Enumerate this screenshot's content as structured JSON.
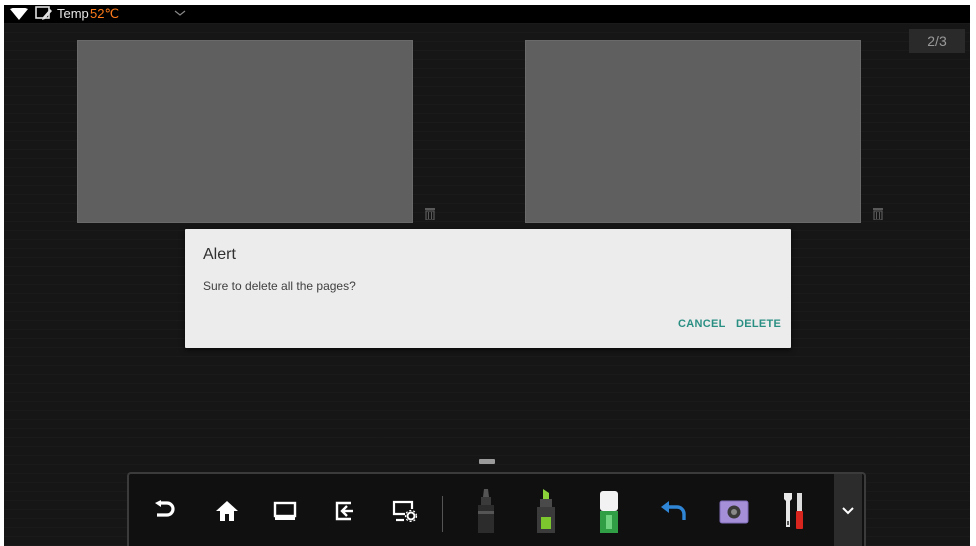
{
  "status_bar": {
    "temp_label": "Temp",
    "temp_value": "52℃",
    "temp_color": "#ff7a1a",
    "icons": [
      "wifi-icon",
      "whiteboard-icon",
      "chevron-down-icon"
    ]
  },
  "page_counter": "2/3",
  "thumbnails": [
    {
      "name": "page-thumbnail",
      "delete_icon": "trash-icon"
    },
    {
      "name": "page-thumbnail",
      "delete_icon": "trash-icon"
    }
  ],
  "dialog": {
    "title": "Alert",
    "message": "Sure to delete all the pages?",
    "cancel_label": "CANCEL",
    "delete_label": "DELETE",
    "accent_color": "#2a8f83"
  },
  "toolbar": {
    "items": [
      "back-icon",
      "home-icon",
      "window-icon",
      "exit-icon",
      "screen-settings-icon",
      "pen-icon",
      "highlighter-icon",
      "eraser-icon",
      "undo-icon",
      "camera-icon",
      "tools-icon",
      "expand-chevron-icon"
    ]
  }
}
